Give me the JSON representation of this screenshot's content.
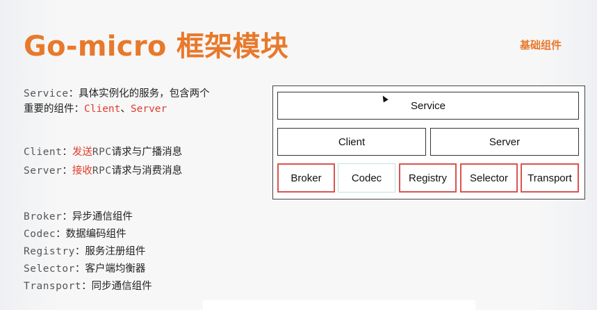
{
  "slide": {
    "title": "Go-micro 框架模块",
    "corner_tag": "基础组件"
  },
  "left_text": {
    "service": {
      "term": "Service",
      "sep": "：",
      "desc1": "具体实例化的服务，包含两个",
      "desc2": "重要的组件：",
      "client": "Client",
      "comma": "、",
      "server": "Server"
    },
    "client_line": {
      "term": "Client",
      "sep": "：",
      "verb": "发送",
      "rpc": "RPC",
      "rest": "请求与广播消息"
    },
    "server_line": {
      "term": "Server",
      "sep": "：",
      "verb": "接收",
      "rpc": "RPC",
      "rest": "请求与消费消息"
    },
    "components": [
      {
        "term": "Broker",
        "sep": "：",
        "desc": "异步通信组件"
      },
      {
        "term": "Codec",
        "sep": "：",
        "desc": "数据编码组件"
      },
      {
        "term": "Registry",
        "sep": "：",
        "desc": "服务注册组件"
      },
      {
        "term": "Selector",
        "sep": "：",
        "desc": "客户端均衡器"
      },
      {
        "term": "Transport",
        "sep": "：",
        "desc": "同步通信组件"
      }
    ]
  },
  "diagram": {
    "service": "Service",
    "client": "Client",
    "server": "Server",
    "components": [
      "Broker",
      "Codec",
      "Registry",
      "Selector",
      "Transport"
    ]
  },
  "colors": {
    "title_orange": "#e8792b",
    "highlight_red": "#e23c2b",
    "box_red": "#d9534f"
  },
  "icons": {
    "cursor": "mouse-pointer-icon"
  }
}
